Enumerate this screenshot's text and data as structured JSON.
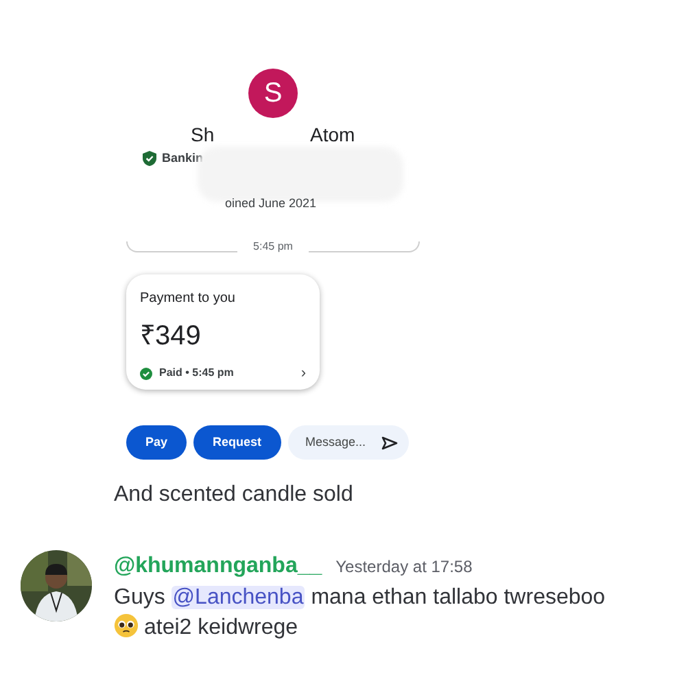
{
  "payment_screenshot": {
    "avatar_letter": "S",
    "name_visible_start": "Sh",
    "name_visible_end": "Atom",
    "verified_label": "Bankin",
    "joined": "oined June 2021",
    "divider_time": "5:45 pm",
    "card": {
      "title": "Payment to you",
      "amount": "₹349",
      "status": "Paid • 5:45 pm",
      "paid": true,
      "chevron": "›"
    },
    "actions": [
      {
        "kind": "button",
        "label": "Pay"
      },
      {
        "kind": "button",
        "label": "Request"
      },
      {
        "kind": "field",
        "placeholder": "Message..."
      }
    ]
  },
  "caption": "And scented candle sold",
  "message": {
    "username": "@khumannganba__",
    "timestamp": "Yesterday at 17:58",
    "mention": "@Lanchenba",
    "text_before": "Guys",
    "text_after": "mana ethan tallabo twreseboo",
    "line2": "atei2 keidwrege"
  }
}
